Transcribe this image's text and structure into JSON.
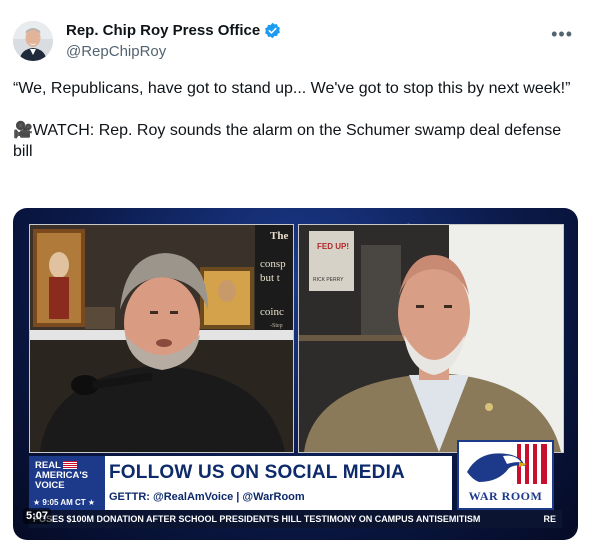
{
  "account": {
    "display_name": "Rep. Chip Roy Press Office",
    "handle": "@RepChipRoy"
  },
  "menu": {
    "more_label": "•••"
  },
  "tweet": {
    "paragraph1": "“We, Republicans, have got to stand up... We've got to stop this by next week!”",
    "paragraph2": "🎥WATCH: Rep. Roy sounds the alarm on the Schumer swamp deal defense bill"
  },
  "video": {
    "timestamp": "5:07",
    "lower_third": {
      "network_line1": "REAL",
      "network_line2": "AMERICA'S",
      "network_line3": "VOICE",
      "clock": "★ 9:05 AM CT ★",
      "headline": "FOLLOW US ON SOCIAL MEDIA",
      "gettr": "GETTR: @RealAmVoice | @WarRoom",
      "show_logo": "WAR ROOM",
      "ticker": "POSES $100M DONATION AFTER SCHOOL PRESIDENT'S HILL TESTIMONY ON CAMPUS ANTISEMITISM",
      "ticker_tail": "RE"
    },
    "backdrop_text_left": [
      "The",
      "consp",
      "but t",
      "coinc",
      "-Step"
    ],
    "book_title_right": "FED UP!",
    "book_author_right": "RICK PERRY"
  },
  "colors": {
    "verified": "#1d9bf0",
    "network_blue": "#1d3a8a",
    "headline_blue": "#0d2a6b"
  }
}
